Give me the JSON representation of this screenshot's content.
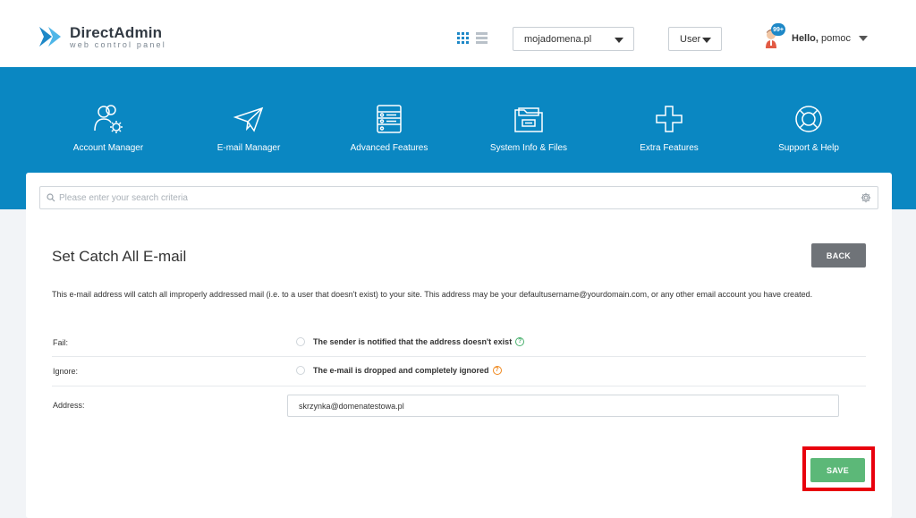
{
  "header": {
    "logo_name": "DirectAdmin",
    "logo_tagline": "web control panel",
    "domain_select": "mojadomena.pl",
    "role_select": "User",
    "notification_count": "99+",
    "greeting": "Hello,",
    "username": "pomoc"
  },
  "nav": {
    "items": [
      {
        "label": "Account Manager",
        "icon": "account-manager-icon"
      },
      {
        "label": "E-mail Manager",
        "icon": "paper-plane-icon"
      },
      {
        "label": "Advanced Features",
        "icon": "server-icon"
      },
      {
        "label": "System Info & Files",
        "icon": "folder-icon"
      },
      {
        "label": "Extra Features",
        "icon": "plus-icon"
      },
      {
        "label": "Support & Help",
        "icon": "lifebuoy-icon"
      }
    ]
  },
  "search": {
    "placeholder": "Please enter your search criteria"
  },
  "page": {
    "title": "Set Catch All E-mail",
    "back_label": "BACK",
    "description": "This e-mail address will catch all improperly addressed mail (i.e. to a user that doesn't exist) to your site. This address may be your defaultusername@yourdomain.com, or any other email account you have created.",
    "options": [
      {
        "label": "Fail:",
        "text": "The sender is notified that the address doesn't exist",
        "selected": false
      },
      {
        "label": "Ignore:",
        "text": "The e-mail is dropped and completely ignored",
        "selected": false
      },
      {
        "label": "Address:",
        "value": "skrzynka@domenatestowa.pl",
        "selected": true
      }
    ],
    "help_glyph": "?",
    "save_label": "SAVE"
  },
  "colors": {
    "accent": "#0a87c2",
    "save": "#5cb878",
    "highlight": "#e8000d"
  }
}
